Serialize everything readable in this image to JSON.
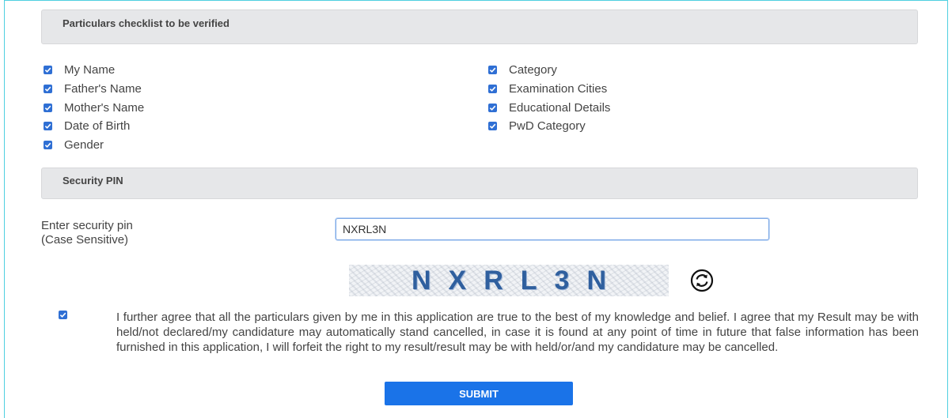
{
  "sections": {
    "particulars_title": "Particulars checklist to be verified",
    "security_title": "Security PIN"
  },
  "checklist": {
    "left": [
      "My Name",
      "Father's Name",
      "Mother's Name",
      "Date of Birth",
      "Gender"
    ],
    "right": [
      "Category",
      "Examination Cities",
      "Educational Details",
      "PwD Category"
    ],
    "all_checked": true
  },
  "security": {
    "label_line1": "Enter security pin",
    "label_line2": "(Case Sensitive)",
    "input_value": "NXRL3N",
    "captcha_text": "NXRL3N"
  },
  "declaration": {
    "checked": true,
    "text": "I further agree that all the particulars given by me in this application are true to the best of my knowledge and belief. I agree that my Result may be with held/not declared/my candidature may automatically stand cancelled, in case it is found at any point of time in future that false information has been furnished in this application, I will forfeit the right to my result/result may be with held/or/and my candidature may be cancelled."
  },
  "submit_label": "SUBMIT",
  "colors": {
    "accent": "#1a73e8",
    "checkbox": "#2f6fd4",
    "frame": "#4fd0e0",
    "header_bg": "#e6e7e9"
  },
  "icons": {
    "checkbox": "check-icon",
    "refresh": "refresh-icon"
  }
}
